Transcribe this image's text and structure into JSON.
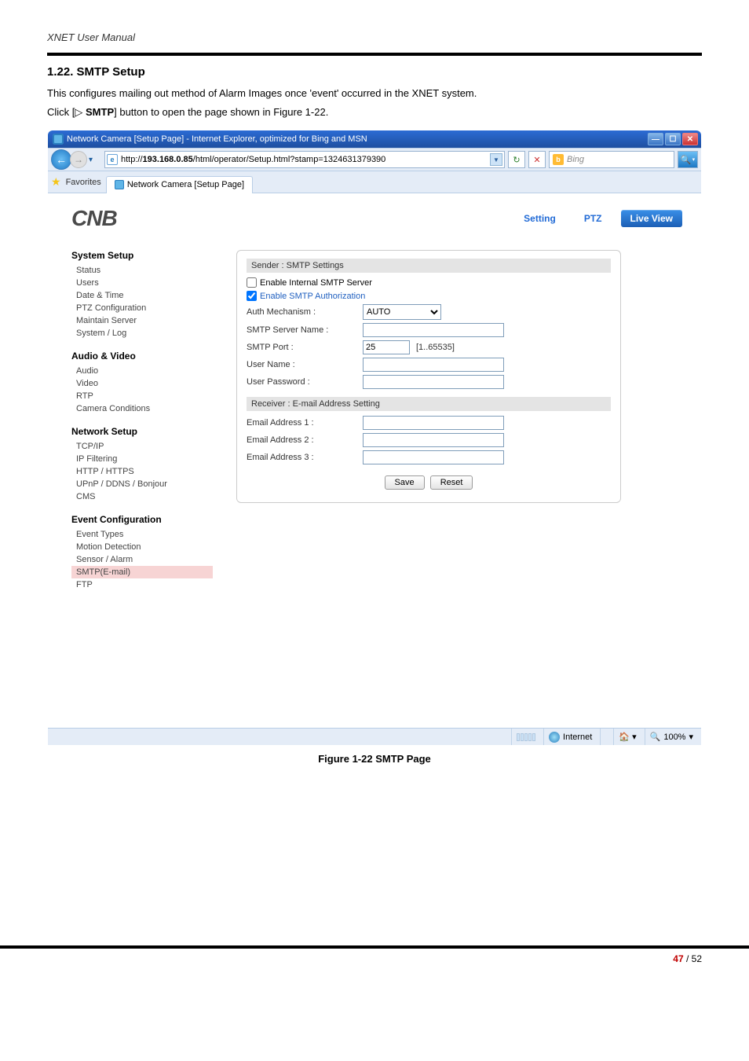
{
  "doc": {
    "header": "XNET User Manual",
    "section_title": "1.22. SMTP Setup",
    "p1_a": "This configures mailing out method of Alarm Images once 'event' occurred in the XNET system.",
    "p2_a": "Click [",
    "p2_tri": "▷",
    "p2_b": " SMTP",
    "p2_c": "] button to open the page shown in Figure 1-22.",
    "figure_caption": "Figure 1-22 SMTP Page",
    "page_cur": "47",
    "page_sep": " / ",
    "page_total": "52"
  },
  "browser": {
    "title": "Network Camera [Setup Page] - Internet Explorer, optimized for Bing and MSN",
    "url_prefix": "http://",
    "url_host": "193.168.0.85",
    "url_rest": "/html/operator/Setup.html?stamp=1324631379390",
    "search_placeholder": "Bing",
    "fav_label": "Favorites",
    "tab_label": "Network Camera [Setup Page]",
    "status_label": "Internet",
    "zoom": "100%"
  },
  "ui": {
    "logo": "CNB",
    "btn_setting": "Setting",
    "btn_ptz": "PTZ",
    "btn_live": "Live View"
  },
  "sidebar": {
    "g1_title": "System Setup",
    "g1": [
      "Status",
      "Users",
      "Date & Time",
      "PTZ Configuration",
      "Maintain Server",
      "System / Log"
    ],
    "g2_title": "Audio & Video",
    "g2": [
      "Audio",
      "Video",
      "RTP",
      "Camera Conditions"
    ],
    "g3_title": "Network Setup",
    "g3": [
      "TCP/IP",
      "IP Filtering",
      "HTTP / HTTPS",
      "UPnP / DDNS / Bonjour",
      "CMS"
    ],
    "g4_title": "Event Configuration",
    "g4": [
      "Event Types",
      "Motion Detection",
      "Sensor / Alarm",
      "SMTP(E-mail)",
      "FTP"
    ]
  },
  "form": {
    "sender_section": "Sender : SMTP Settings",
    "chk_internal": "Enable Internal SMTP Server",
    "chk_auth": "Enable SMTP Authorization",
    "lbl_mech": "Auth Mechanism :",
    "mech_value": "AUTO",
    "lbl_server": "SMTP Server Name :",
    "lbl_port": "SMTP Port :",
    "port_value": "25",
    "port_range": "[1..65535]",
    "lbl_user": "User Name :",
    "lbl_pass": "User Password :",
    "receiver_section": "Receiver : E-mail Address Setting",
    "lbl_e1": "Email Address 1 :",
    "lbl_e2": "Email Address 2 :",
    "lbl_e3": "Email Address 3 :",
    "btn_save": "Save",
    "btn_reset": "Reset"
  }
}
